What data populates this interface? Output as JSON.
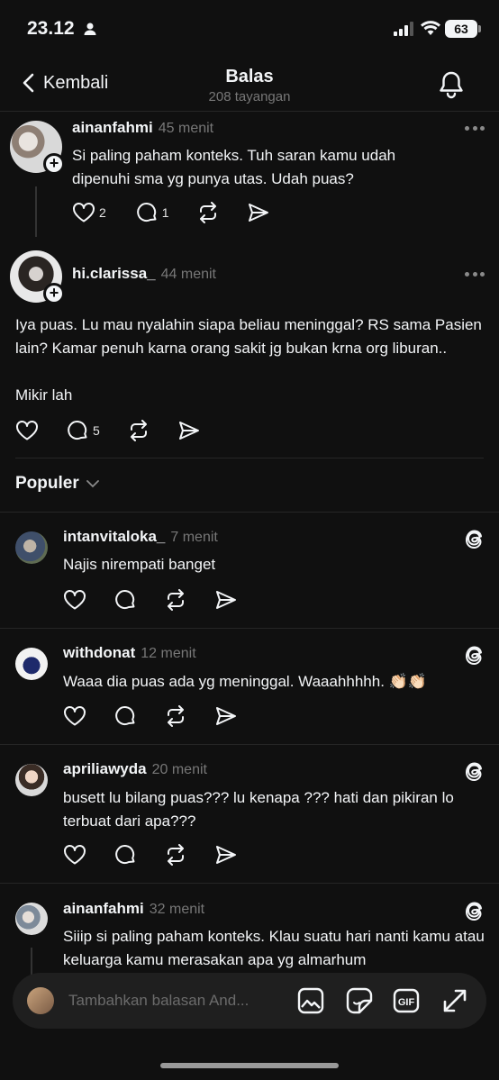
{
  "status_bar": {
    "time": "23.12",
    "battery": "63"
  },
  "header": {
    "back_label": "Kembali",
    "title": "Balas",
    "subtitle": "208 tayangan"
  },
  "posts": [
    {
      "username": "ainanfahmi",
      "time": "45 menit",
      "text": "Si paling paham konteks. Tuh saran kamu udah dipenuhi sma yg punya utas. Udah puas?",
      "likes": "2",
      "replies": "1"
    },
    {
      "username": "hi.clarissa_",
      "time": "44 menit",
      "text_lines": [
        "Iya puas. Lu mau nyalahin siapa beliau meninggal? RS sama Pasien lain? Kamar penuh karna orang sakit jg bukan krna org liburan..",
        "Mikir lah"
      ],
      "likes": "",
      "replies": "5"
    }
  ],
  "section": {
    "label": "Populer"
  },
  "replies": [
    {
      "username": "intanvitaloka_",
      "time": "7 menit",
      "text": "Najis nirempati banget"
    },
    {
      "username": "withdonat",
      "time": "12 menit",
      "text": "Waaa dia puas ada yg meninggal. Waaahhhhh. 👏🏻👏🏻"
    },
    {
      "username": "apriliawyda",
      "time": "20 menit",
      "text": "busett lu bilang puas??? lu kenapa ??? hati dan pikiran lo terbuat dari apa???"
    },
    {
      "username": "ainanfahmi",
      "time": "32 menit",
      "text": "Siiip si paling paham konteks. Klau suatu hari nanti kamu atau keluarga kamu merasakan apa yg almarhum"
    }
  ],
  "compose": {
    "placeholder": "Tambahkan balasan And..."
  },
  "icons": [
    "back-chevron-icon",
    "bell-icon",
    "heart-icon",
    "comment-icon",
    "repost-icon",
    "share-icon",
    "more-icon",
    "threads-icon",
    "image-icon",
    "sticker-icon",
    "gif-icon",
    "expand-icon"
  ]
}
